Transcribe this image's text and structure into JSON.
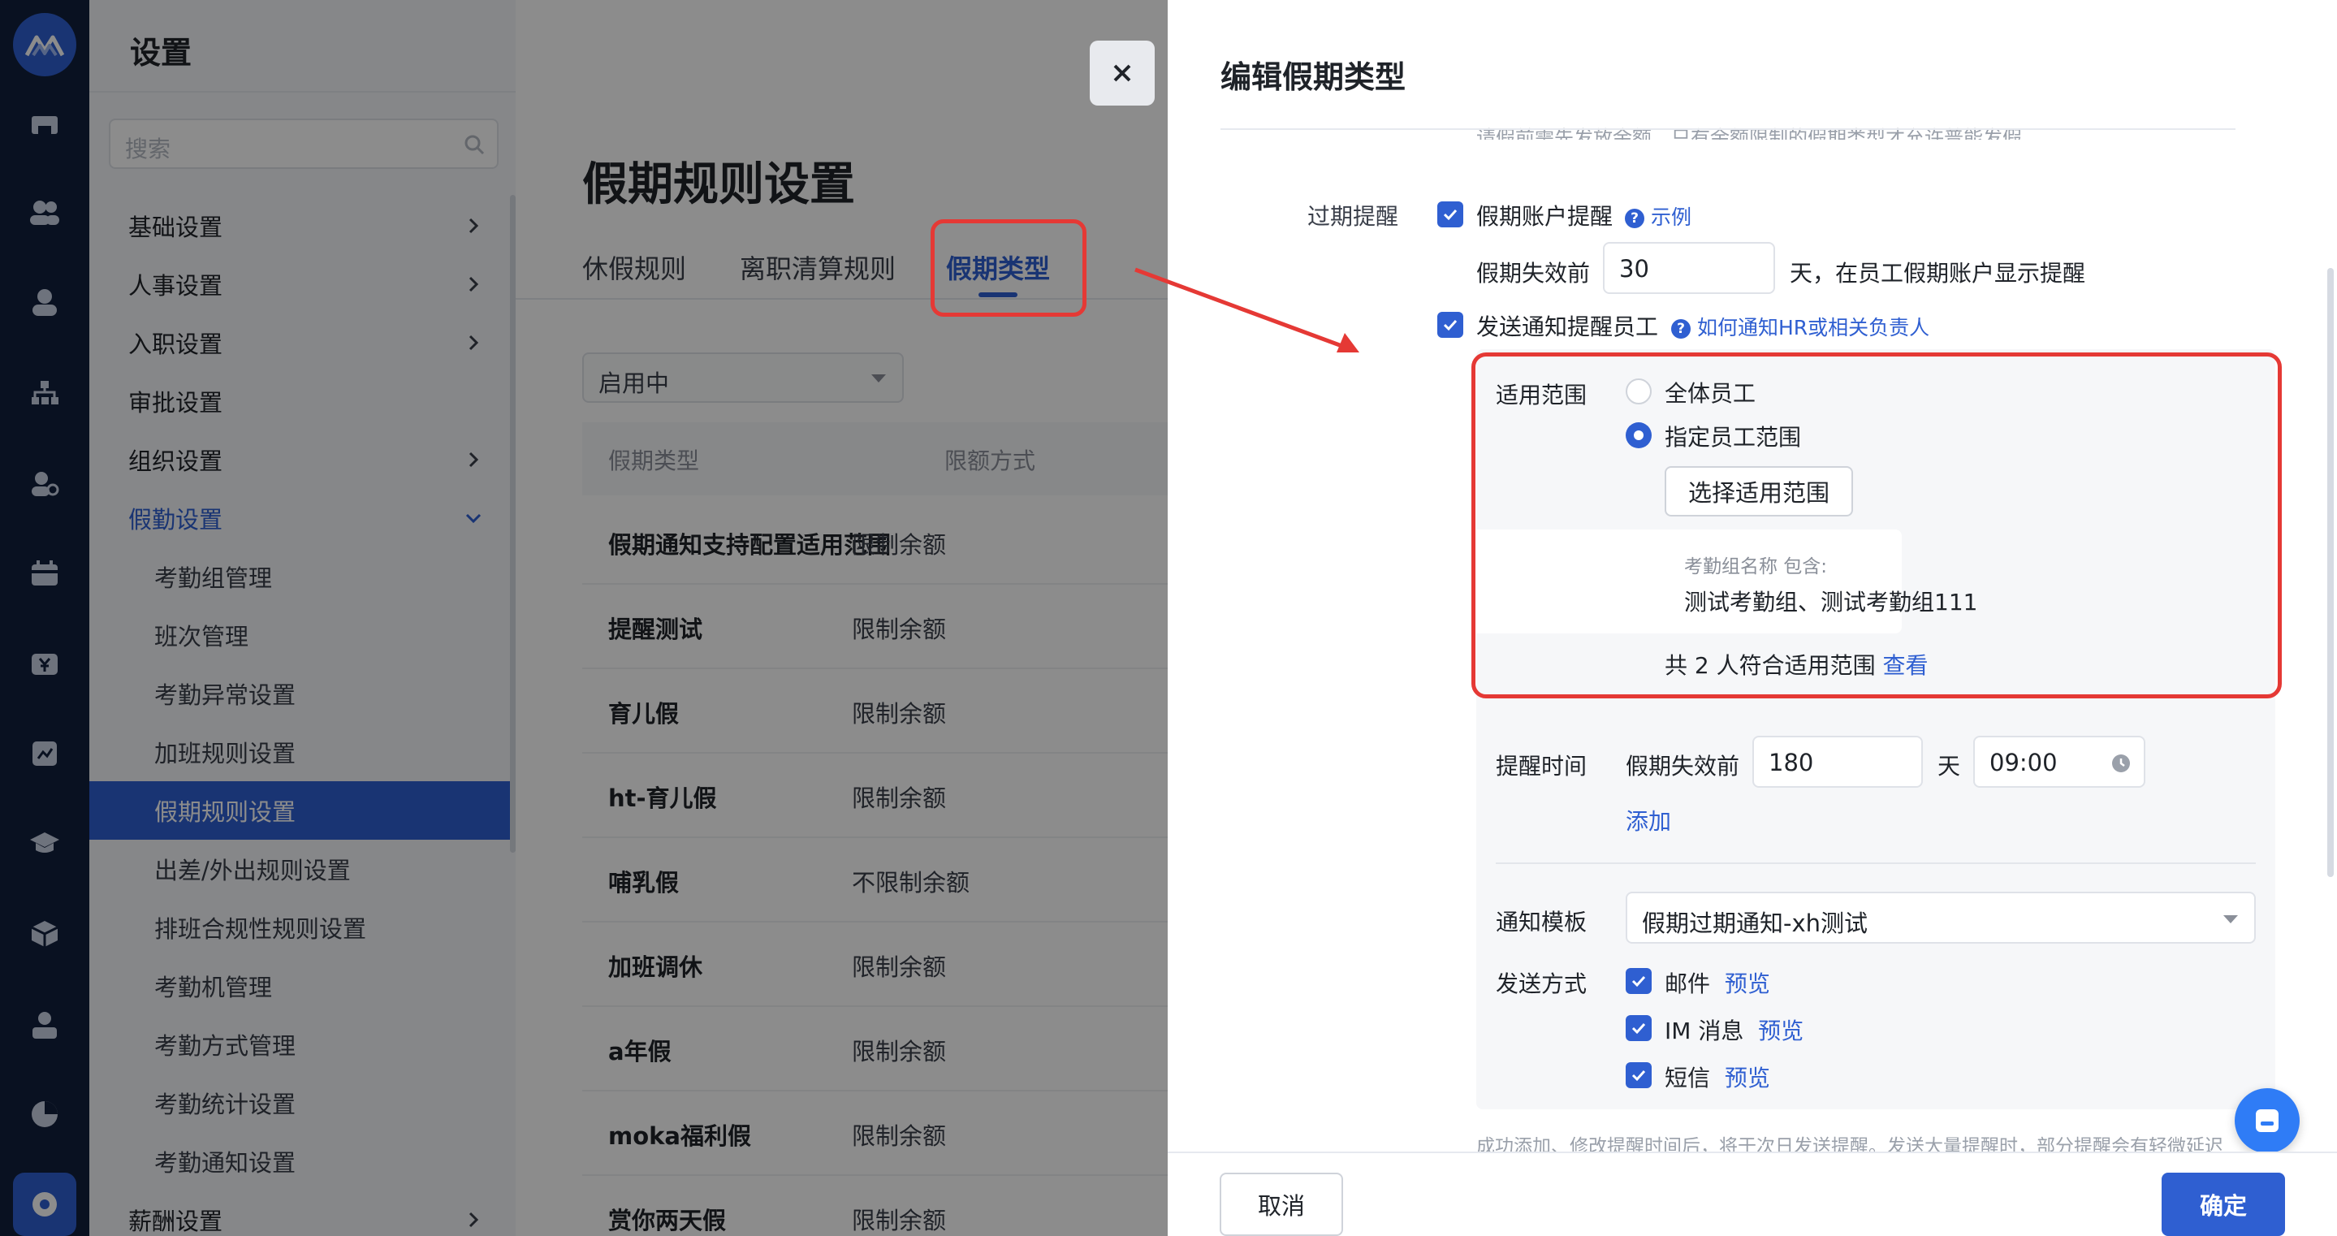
{
  "sidebar": {
    "title": "设置",
    "search_placeholder": "搜索",
    "items": [
      {
        "label": "基础设置",
        "level": 1,
        "arrow": "right"
      },
      {
        "label": "人事设置",
        "level": 1,
        "arrow": "right"
      },
      {
        "label": "入职设置",
        "level": 1,
        "arrow": "right"
      },
      {
        "label": "审批设置",
        "level": 1,
        "arrow": "none"
      },
      {
        "label": "组织设置",
        "level": 1,
        "arrow": "right"
      },
      {
        "label": "假勤设置",
        "level": 1,
        "arrow": "down",
        "state": "open"
      },
      {
        "label": "考勤组管理",
        "level": 2
      },
      {
        "label": "班次管理",
        "level": 2
      },
      {
        "label": "考勤异常设置",
        "level": 2
      },
      {
        "label": "加班规则设置",
        "level": 2
      },
      {
        "label": "假期规则设置",
        "level": 2,
        "state": "selected"
      },
      {
        "label": "出差/外出规则设置",
        "level": 2
      },
      {
        "label": "排班合规性规则设置",
        "level": 2
      },
      {
        "label": "考勤机管理",
        "level": 2
      },
      {
        "label": "考勤方式管理",
        "level": 2
      },
      {
        "label": "考勤统计设置",
        "level": 2
      },
      {
        "label": "考勤通知设置",
        "level": 2
      },
      {
        "label": "薪酬设置",
        "level": 1,
        "arrow": "right"
      }
    ]
  },
  "main": {
    "title": "假期规则设置",
    "tabs": [
      {
        "label": "休假规则"
      },
      {
        "label": "离职清算规则"
      },
      {
        "label": "假期类型",
        "active": true
      }
    ],
    "filter_value": "启用中",
    "table": {
      "headers": [
        "假期类型",
        "限额方式"
      ],
      "rows": [
        [
          "假期通知支持配置适用范围",
          "限制余额"
        ],
        [
          "提醒测试",
          "限制余额"
        ],
        [
          "育儿假",
          "限制余额"
        ],
        [
          "ht-育儿假",
          "限制余额"
        ],
        [
          "哺乳假",
          "不限制余额"
        ],
        [
          "加班调休",
          "限制余额"
        ],
        [
          "a年假",
          "限制余额"
        ],
        [
          "moka福利假",
          "限制余额"
        ],
        [
          "赏你两天假",
          "限制余额"
        ]
      ]
    }
  },
  "drawer": {
    "title": "编辑假期类型",
    "cut_text": "请假前需先发放余额，只有余额限制的假期类型才允许普能发假",
    "expiry_label": "过期提醒",
    "account_reminder": {
      "label": "假期账户提醒",
      "help": "示例",
      "checked": true
    },
    "before_label": "假期失效前",
    "days_value": "30",
    "days_suffix": "天，在员工假期账户显示提醒",
    "notify_employee": {
      "label": "发送通知提醒员工",
      "help": "如何通知HR或相关负责人",
      "checked": true
    },
    "scope": {
      "label": "适用范围",
      "options": [
        {
          "label": "全体员工",
          "selected": false
        },
        {
          "label": "指定员工范围",
          "selected": true
        }
      ],
      "button": "选择适用范围",
      "info_title": "考勤组名称 包含:",
      "info_value": "测试考勤组、测试考勤组111",
      "count_prefix": "共 2 人符合适用范围",
      "count_link": "查看"
    },
    "reminder_time": {
      "label": "提醒时间",
      "before_label": "假期失效前",
      "days": "180",
      "unit": "天",
      "time": "09:00",
      "add": "添加"
    },
    "template": {
      "label": "通知模板",
      "value": "假期过期通知-xh测试"
    },
    "methods": {
      "label": "发送方式",
      "items": [
        {
          "label": "邮件",
          "link": "预览",
          "checked": true
        },
        {
          "label": "IM 消息",
          "link": "预览",
          "checked": true
        },
        {
          "label": "短信",
          "link": "预览",
          "checked": true
        }
      ]
    },
    "note": "成功添加、修改提醒时间后，将于次日发送提醒。发送大量提醒时，部分提醒会有轻微延迟",
    "cancel": "取消",
    "confirm": "确定"
  },
  "close_label": "×",
  "colors": {
    "accent": "#2f5fd1",
    "highlight": "#e53935",
    "rail": "#12203d"
  }
}
